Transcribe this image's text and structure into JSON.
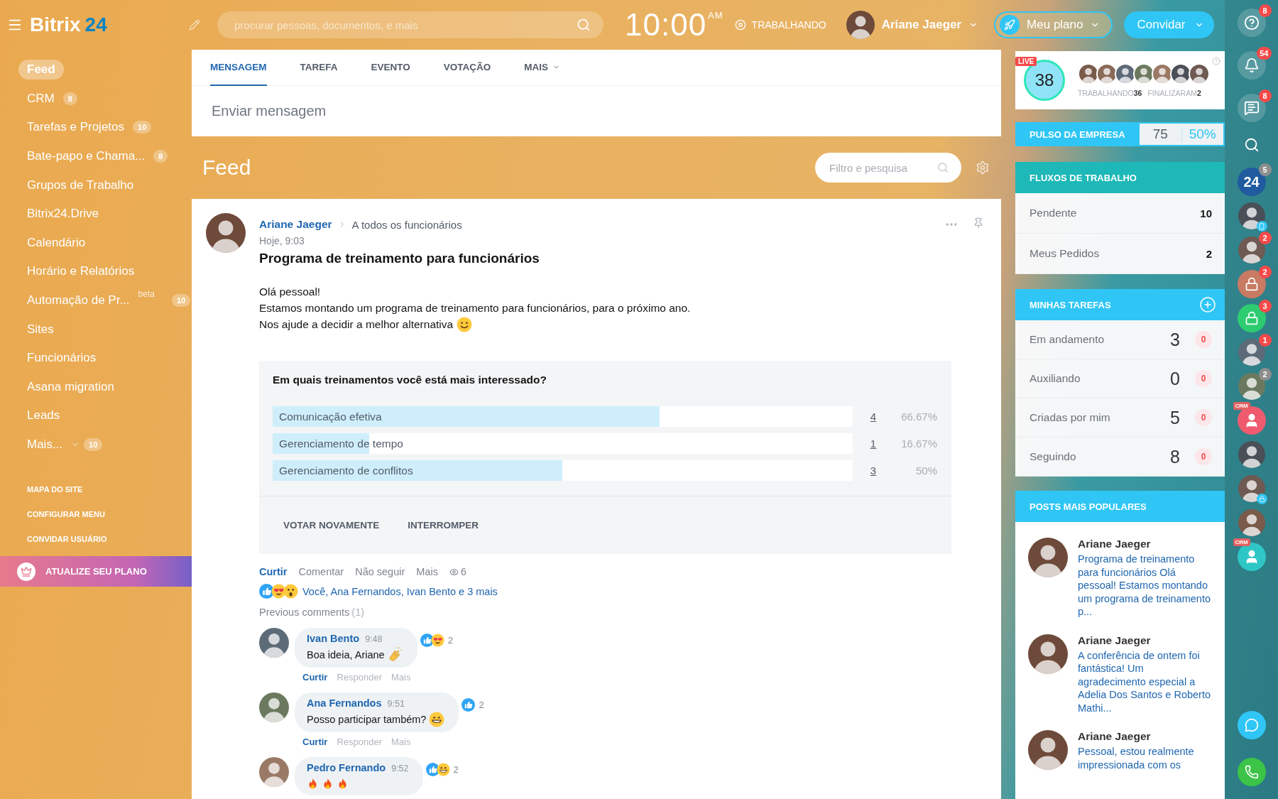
{
  "header": {
    "logo_text": "Bitrix",
    "logo_number": "24",
    "search": {
      "placeholder": "procurar pessoas, documentos, e mais"
    },
    "clock": {
      "time": "10:00",
      "period": "AM"
    },
    "status": "TRABALHANDO",
    "user": {
      "name": "Ariane Jaeger"
    },
    "plan_button": "Meu plano",
    "invite_button": "Convidar"
  },
  "sidebar": {
    "items": [
      {
        "label": "Feed",
        "selected": true
      },
      {
        "label": "CRM",
        "count": "8",
        "selected": false
      },
      {
        "label": "Tarefas e Projetos",
        "count": "10",
        "selected": false
      },
      {
        "label": "Bate-papo e Chama...",
        "count": "8",
        "selected": false
      },
      {
        "label": "Grupos de Trabalho",
        "selected": false
      },
      {
        "label": "Bitrix24.Drive",
        "selected": false
      },
      {
        "label": "Calendário",
        "selected": false
      },
      {
        "label": "Horário e Relatórios",
        "selected": false
      },
      {
        "label": "Automação de Pr...",
        "tag": "beta",
        "count": "10",
        "selected": false
      },
      {
        "label": "Sites",
        "selected": false
      },
      {
        "label": "Funcionários",
        "selected": false
      },
      {
        "label": "Asana migration",
        "selected": false
      },
      {
        "label": "Leads",
        "selected": false
      },
      {
        "label": "Mais...",
        "count": "10",
        "dropdown": true,
        "selected": false
      }
    ],
    "links": [
      "MAPA DO SITE",
      "CONFIGURAR MENU",
      "CONVIDAR USUÁRIO"
    ],
    "upgrade": "ATUALIZE SEU PLANO"
  },
  "composer": {
    "tabs": [
      {
        "label": "MENSAGEM",
        "selected": true
      },
      {
        "label": "TAREFA",
        "selected": false
      },
      {
        "label": "EVENTO",
        "selected": false
      },
      {
        "label": "VOTAÇÃO",
        "selected": false
      },
      {
        "label": "MAIS",
        "dropdown": true,
        "selected": false
      }
    ],
    "placeholder": "Enviar mensagem"
  },
  "feed": {
    "title": "Feed",
    "filter": {
      "placeholder": "Filtro e pesquisa"
    },
    "post": {
      "author": "Ariane Jaeger",
      "audience": "A todos os funcionários",
      "time": "Hoje, 9:03",
      "title": "Programa de treinamento para funcionários",
      "body": [
        {
          "text": "Olá pessoal!"
        },
        {
          "text": "Estamos montando um programa de treinamento para funcionários, para o próximo ano."
        },
        {
          "text": "Nos ajude a decidir a melhor alternativa",
          "emoji": [
            {
              "kind": "smile"
            }
          ]
        }
      ],
      "poll": {
        "question": "Em quais treinamentos você está mais interessado?",
        "options": [
          {
            "label": "Comunicação efetiva",
            "votes": "4",
            "percent": "66.67%",
            "level": 0.6667
          },
          {
            "label": "Gerenciamento de tempo",
            "votes": "1",
            "percent": "16.67%",
            "level": 0.1667
          },
          {
            "label": "Gerenciamento de conflitos",
            "votes": "3",
            "percent": "50%",
            "level": 0.5
          }
        ],
        "actions": [
          "VOTAR NOVAMENTE",
          "INTERROMPER"
        ]
      },
      "actions": [
        "Curtir",
        "Comentar",
        "Não seguir",
        "Mais"
      ],
      "views": "6",
      "reactions": [
        {
          "kind": "like"
        },
        {
          "kind": "love"
        },
        {
          "kind": "wow"
        }
      ],
      "reactions_text": "Você, Ana Fernandos, Ivan Bento e 3 mais",
      "previous_comments": {
        "label": "Previous comments",
        "count": "(1)"
      },
      "comments": [
        {
          "author": "Ivan Bento",
          "time": "9:48",
          "text": "Boa ideia, Ariane",
          "emoji": [
            {
              "kind": "clap"
            }
          ],
          "reactions": [
            {
              "kind": "like"
            },
            {
              "kind": "love"
            }
          ],
          "reaction_count": "2",
          "actions": [
            "Curtir",
            "Responder",
            "Mais"
          ]
        },
        {
          "author": "Ana Fernandos",
          "time": "9:51",
          "text": "Posso participar também?",
          "emoji": [
            {
              "kind": "grin"
            }
          ],
          "reactions": [
            {
              "kind": "like"
            }
          ],
          "reaction_count": "2",
          "actions": [
            "Curtir",
            "Responder",
            "Mais"
          ]
        },
        {
          "author": "Pedro Fernando",
          "time": "9:52",
          "emoji": [
            {
              "kind": "fire"
            },
            {
              "kind": "fire"
            },
            {
              "kind": "fire"
            }
          ],
          "reactions": [
            {
              "kind": "like"
            },
            {
              "kind": "grin"
            }
          ],
          "reaction_count": "2"
        }
      ]
    }
  },
  "live": {
    "badge": "LIVE",
    "count": "38",
    "working_label": "TRABALHANDO",
    "working": "36",
    "finished_label": "FINALIZARAM",
    "finished": "2"
  },
  "pulse": {
    "label": "PULSO DA EMPRESA",
    "value": "75",
    "percent": "50%"
  },
  "workflows": {
    "title": "FLUXOS DE TRABALHO",
    "rows": [
      {
        "label": "Pendente",
        "value": "10"
      },
      {
        "label": "Meus Pedidos",
        "value": "2"
      }
    ]
  },
  "tasks": {
    "title": "MINHAS TAREFAS",
    "rows": [
      {
        "label": "Em andamento",
        "value": "3",
        "overdue": "0"
      },
      {
        "label": "Auxiliando",
        "value": "0",
        "overdue": "0"
      },
      {
        "label": "Criadas por mim",
        "value": "5",
        "overdue": "0"
      },
      {
        "label": "Seguindo",
        "value": "8",
        "overdue": "0"
      }
    ]
  },
  "popular": {
    "title": "POSTS MAIS POPULARES",
    "posts": [
      {
        "author": "Ariane Jaeger",
        "text": "Programa de treinamento para funcionários Olá pessoal! Estamos montando um programa de treinamento p..."
      },
      {
        "author": "Ariane Jaeger",
        "text": "A conferência de ontem foi fantástica! Um agradecimento especial a Adelia Dos Santos e Roberto Mathi..."
      },
      {
        "author": "Ariane Jaeger",
        "text": "Pessoal, estou realmente impressionada com os"
      }
    ]
  },
  "rail": {
    "items": [
      {
        "kind": "help",
        "badge": "8",
        "badge_muted": false
      },
      {
        "kind": "bell",
        "badge": "54",
        "badge_muted": false
      },
      {
        "kind": "chat",
        "badge": "8",
        "badge_muted": false
      },
      {
        "kind": "search"
      },
      {
        "kind": "logo",
        "label": "24",
        "badge": "5",
        "badge_muted": true
      },
      {
        "kind": "avatar",
        "mobile": true
      },
      {
        "kind": "avatar",
        "badge": "2",
        "badge_muted": false
      },
      {
        "kind": "lock",
        "color": "#c87a62",
        "badge": "2",
        "badge_muted": false
      },
      {
        "kind": "lock",
        "color": "#2ecc71",
        "badge": "3",
        "badge_muted": false
      },
      {
        "kind": "avatar",
        "badge": "1",
        "badge_muted": false
      },
      {
        "kind": "avatar",
        "badge": "2",
        "badge_muted": true
      },
      {
        "kind": "crm",
        "tag": "CRM",
        "color": "#ef5a6f"
      },
      {
        "kind": "avatar"
      },
      {
        "kind": "avatar",
        "locked": true
      },
      {
        "kind": "avatar"
      },
      {
        "kind": "crm",
        "tag": "CRM",
        "color": "#2fc6c6"
      }
    ],
    "bottom": [
      {
        "kind": "chat"
      },
      {
        "kind": "phone"
      }
    ]
  }
}
